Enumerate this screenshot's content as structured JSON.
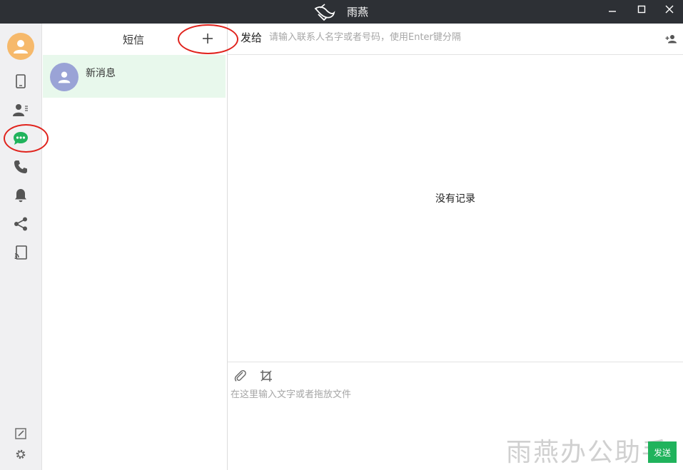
{
  "window": {
    "title": "雨燕",
    "logo_icon": "swallow-logo-icon",
    "controls": [
      "minimize-icon",
      "maximize-icon",
      "close-icon"
    ]
  },
  "nav": {
    "items": [
      {
        "name": "phone",
        "icon": "mobile-phone-icon"
      },
      {
        "name": "contacts",
        "icon": "contacts-icon"
      },
      {
        "name": "messages",
        "icon": "chat-bubble-icon",
        "active": true
      },
      {
        "name": "calls",
        "icon": "phone-call-icon"
      },
      {
        "name": "notifications",
        "icon": "bell-icon"
      },
      {
        "name": "share",
        "icon": "share-icon"
      },
      {
        "name": "screen-cast",
        "icon": "cast-icon"
      }
    ],
    "bottom": [
      {
        "name": "feedback",
        "icon": "edit-icon"
      },
      {
        "name": "settings",
        "icon": "gear-icon"
      }
    ],
    "active_color": "#20b35c"
  },
  "list": {
    "title": "短信",
    "add_icon": "plus-icon",
    "conversations": [
      {
        "name": "新消息",
        "avatar_icon": "person-avatar-icon",
        "selected": true
      }
    ]
  },
  "chat": {
    "to_label": "发给",
    "to_placeholder": "请输入联系人名字或者号码，使用Enter键分隔",
    "empty_text": "没有记录",
    "compose_placeholder": "在这里输入文字或者拖放文件",
    "send_label": "发送",
    "watermark": "雨燕办公助手"
  },
  "colors": {
    "titlebar": "#2d3035",
    "accent": "#20b35c",
    "selected_row": "#e8f8ec",
    "annotation": "#e0231d"
  }
}
